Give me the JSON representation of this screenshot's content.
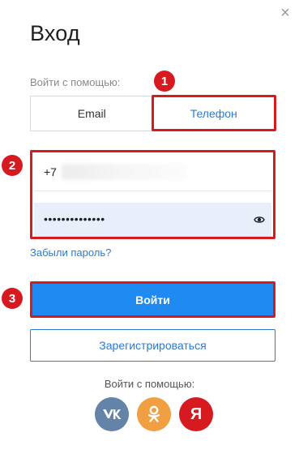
{
  "header": {
    "title": "Вход",
    "close_icon": "close-icon"
  },
  "auth": {
    "login_with_label": "Войти с помощью:",
    "tabs": [
      {
        "label": "Email",
        "active": false
      },
      {
        "label": "Телефон",
        "active": true
      }
    ]
  },
  "form": {
    "phone_prefix": "+7",
    "password_value": "••••••••••••••",
    "eye_icon": "eye-icon"
  },
  "links": {
    "forgot": "Забыли пароль?"
  },
  "buttons": {
    "login": "Войти",
    "register": "Зарегистрироваться"
  },
  "social": {
    "label": "Войти с помощью:",
    "items": [
      {
        "name": "vk-icon",
        "glyph": "vk"
      },
      {
        "name": "ok-icon",
        "glyph": "ок"
      },
      {
        "name": "yandex-icon",
        "glyph": "Я"
      }
    ]
  },
  "annotations": [
    "1",
    "2",
    "3"
  ],
  "colors": {
    "accent": "#1f8bf2",
    "link": "#2a7bd3",
    "highlight": "#d71920",
    "password_bg": "#e9effa"
  }
}
